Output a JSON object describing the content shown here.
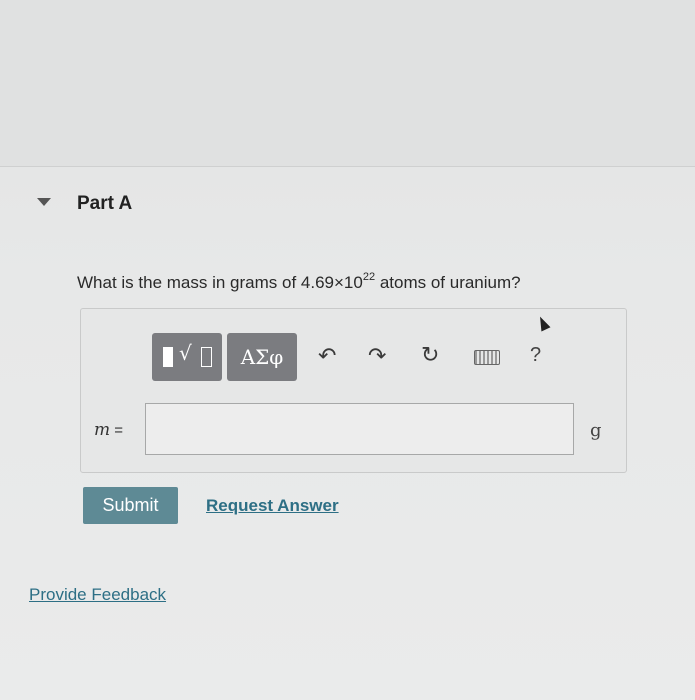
{
  "part": {
    "title": "Part A"
  },
  "question": {
    "prefix": "What is the mass in grams of 4.69×10",
    "exponent": "22",
    "suffix": " atoms of uranium?"
  },
  "toolbar": {
    "greek_label": "ΑΣφ",
    "undo_symbol": "↶",
    "redo_symbol": "↷",
    "reset_symbol": "↻",
    "help_label": "?"
  },
  "answer": {
    "variable": "m",
    "equals": " =",
    "value": "",
    "unit": "g"
  },
  "actions": {
    "submit_label": "Submit",
    "request_label": "Request Answer"
  },
  "footer": {
    "feedback_label": "Provide Feedback"
  },
  "colors": {
    "submit_bg": "#5e8a95",
    "link": "#2d6f85",
    "toolbar_btn": "#7b7c80"
  }
}
